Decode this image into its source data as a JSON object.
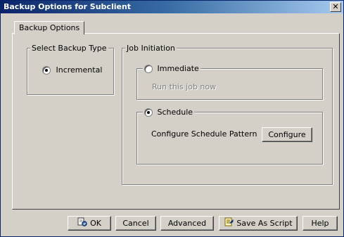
{
  "window": {
    "title": "Backup Options for Subclient",
    "close_glyph": "✕"
  },
  "tab": {
    "label": "Backup Options"
  },
  "backup_type": {
    "legend": "Select Backup Type",
    "option_label": "Incremental",
    "selected": true
  },
  "job_initiation": {
    "legend": "Job Initiation",
    "immediate": {
      "label": "Immediate",
      "selected": false,
      "description": "Run this job now"
    },
    "schedule": {
      "label": "Schedule",
      "selected": true,
      "description": "Configure Schedule Pattern",
      "configure_button": "Configure"
    }
  },
  "buttons": {
    "ok": "OK",
    "cancel": "Cancel",
    "advanced": "Advanced",
    "save_as_script": "Save As Script",
    "help": "Help"
  },
  "icons": {
    "ok": "ok-icon",
    "save_as_script": "script-icon"
  }
}
